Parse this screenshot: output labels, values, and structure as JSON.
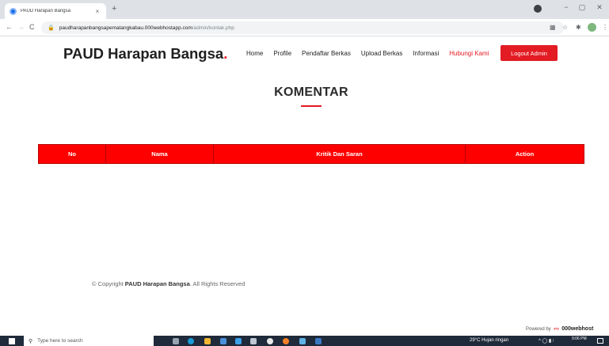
{
  "browser": {
    "tab_title": "PAUD Harapan Bangsa",
    "tab_close": "×",
    "new_tab": "+",
    "url_host": "paudharapanbangsapematangkabau.000webhostapp.com",
    "url_path": "/admin/kontak.php",
    "window_controls": {
      "minimize": "−",
      "maximize": "▢",
      "close": "✕"
    },
    "nav": {
      "back": "←",
      "forward": "→",
      "reload": "C"
    }
  },
  "site": {
    "brand": "PAUD Harapan Bangsa",
    "brand_dot": ".",
    "nav": [
      "Home",
      "Profile",
      "Pendaftar Berkas",
      "Upload Berkas",
      "Informasi",
      "Hubungi Kami"
    ],
    "active_nav": "Hubungi Kami",
    "logout_label": "Logout Admin",
    "accent_color": "#e31b23"
  },
  "main": {
    "heading": "KOMENTAR",
    "table": {
      "columns": [
        "No",
        "Nama",
        "Kritik Dan Saran",
        "Action"
      ],
      "header_color": "#ff0000",
      "rows": []
    }
  },
  "footer": {
    "copyright_prefix": "© Copyright ",
    "copyright_brand": "PAUD Harapan Bangsa",
    "copyright_suffix": ". All Rights Reserved",
    "powered_by": "Powered by",
    "powered_brand": "000webhost"
  },
  "taskbar": {
    "search_placeholder": "Type here to search",
    "weather": "29°C  Hujan ringan",
    "time": "9:06 PM"
  }
}
